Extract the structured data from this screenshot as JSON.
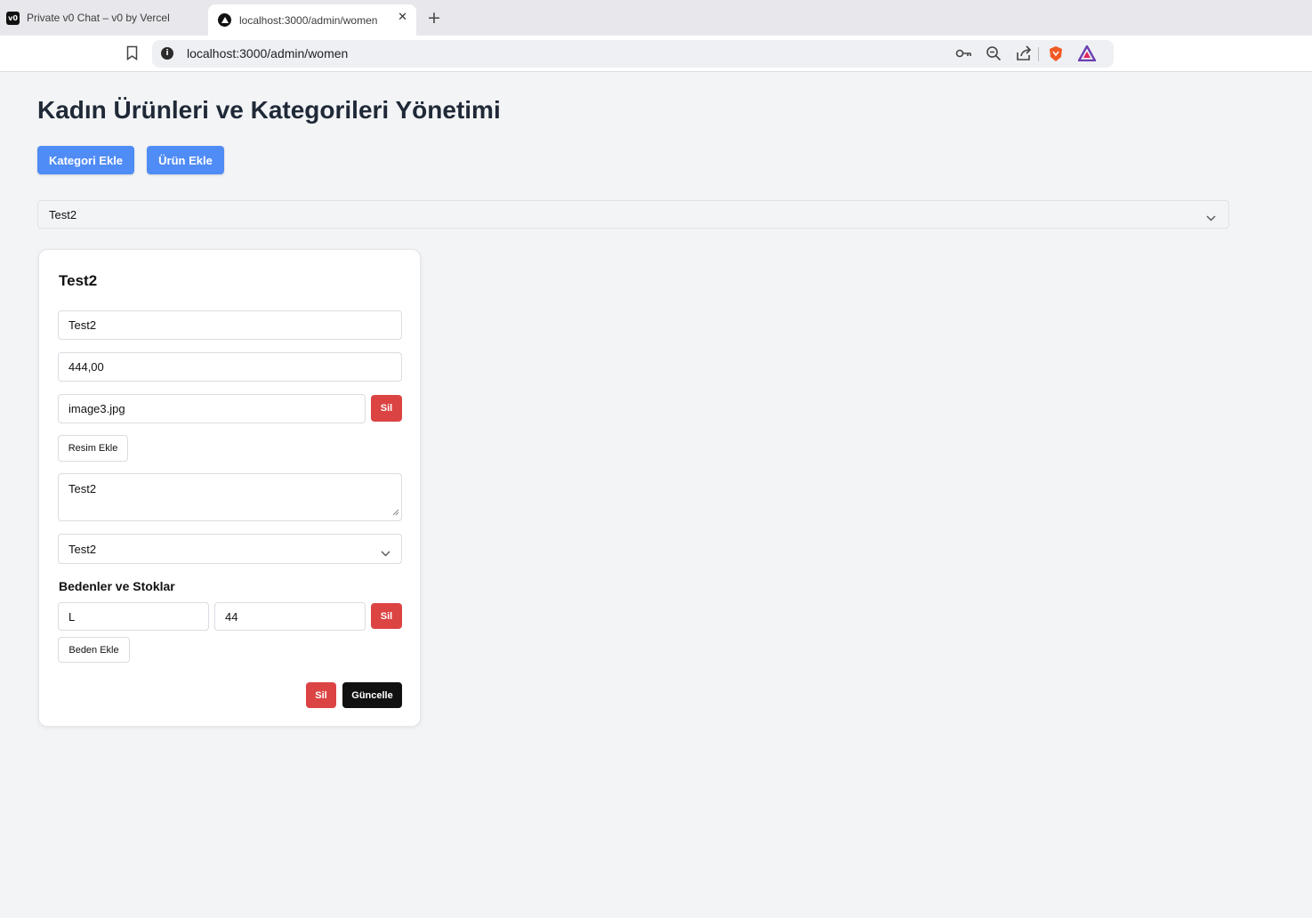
{
  "browser": {
    "tabs": [
      {
        "label": "Private v0 Chat – v0 by Vercel",
        "favicon": "v0-icon",
        "favicon_text": "v0"
      },
      {
        "label": "localhost:3000/admin/women",
        "favicon": "vercel-triangle-icon"
      }
    ],
    "url": "localhost:3000/admin/women"
  },
  "page": {
    "title": "Kadın Ürünleri ve Kategorileri Yönetimi",
    "add_category_label": "Kategori Ekle",
    "add_product_label": "Ürün Ekle",
    "selected_category": "Test2"
  },
  "product": {
    "title": "Test2",
    "name_value": "Test2",
    "price_value": "444,00",
    "image_value": "image3.jpg",
    "delete_image_label": "Sil",
    "add_image_label": "Resim Ekle",
    "description_value": "Test2",
    "category_value": "Test2",
    "sizes_heading": "Bedenler ve Stoklar",
    "sizes": [
      {
        "size": "L",
        "stock": "44",
        "delete_label": "Sil"
      }
    ],
    "add_size_label": "Beden Ekle",
    "delete_label": "Sil",
    "update_label": "Güncelle"
  },
  "colors": {
    "primary_button": "#4f8cf5",
    "danger_button": "#dc4444",
    "dark_button": "#111111",
    "page_background": "#f3f4f6"
  }
}
